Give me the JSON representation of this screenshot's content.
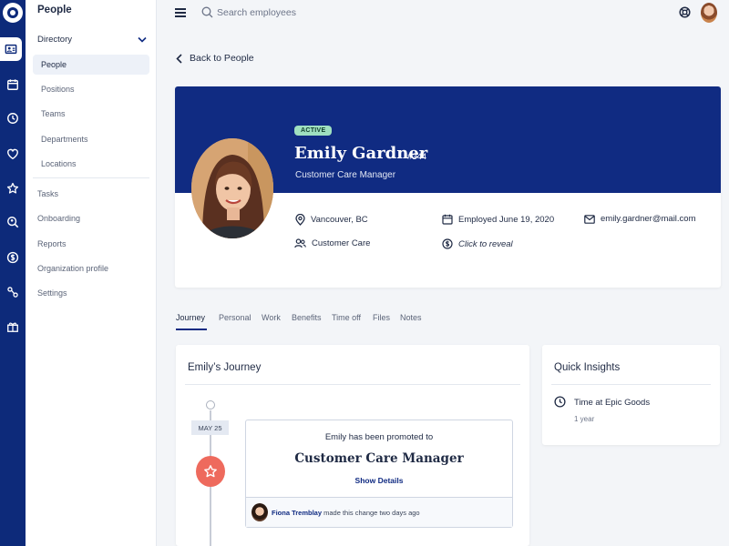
{
  "sidebar": {
    "title": "People",
    "directory_label": "Directory",
    "directory_items": [
      "People",
      "Positions",
      "Teams",
      "Departments",
      "Locations"
    ],
    "items": [
      "Tasks",
      "Onboarding",
      "Reports",
      "Organization profile",
      "Settings"
    ]
  },
  "topbar": {
    "search_placeholder": "Search employees"
  },
  "back_label": "Back to People",
  "profile": {
    "status": "ACTIVE",
    "name": "Emily Gardner",
    "employee_id": "#344",
    "title": "Customer Care Manager",
    "location": "Vancouver, BC",
    "department": "Customer Care",
    "employed": "Employed June 19, 2020",
    "salary": "Click to reveal",
    "email": "emily.gardner@mail.com"
  },
  "tabs": [
    "Journey",
    "Personal",
    "Work",
    "Benefits",
    "Time off",
    "Files",
    "Notes"
  ],
  "journey": {
    "title": "Emily’s Journey",
    "date": "MAY 25",
    "event_text": "Emily has been promoted to",
    "event_role": "Customer Care Manager",
    "show_details": "Show Details",
    "changed_by": "Fiona Tremblay",
    "change_text": "made this change two days ago"
  },
  "insights": {
    "title": "Quick Insights",
    "label": "Time at Epic Goods",
    "value": "1 year"
  },
  "colors": {
    "brand": "#102b82",
    "rail": "#0d2a7a",
    "active_badge": "#9fe0c0",
    "star": "#ee6a5d"
  }
}
